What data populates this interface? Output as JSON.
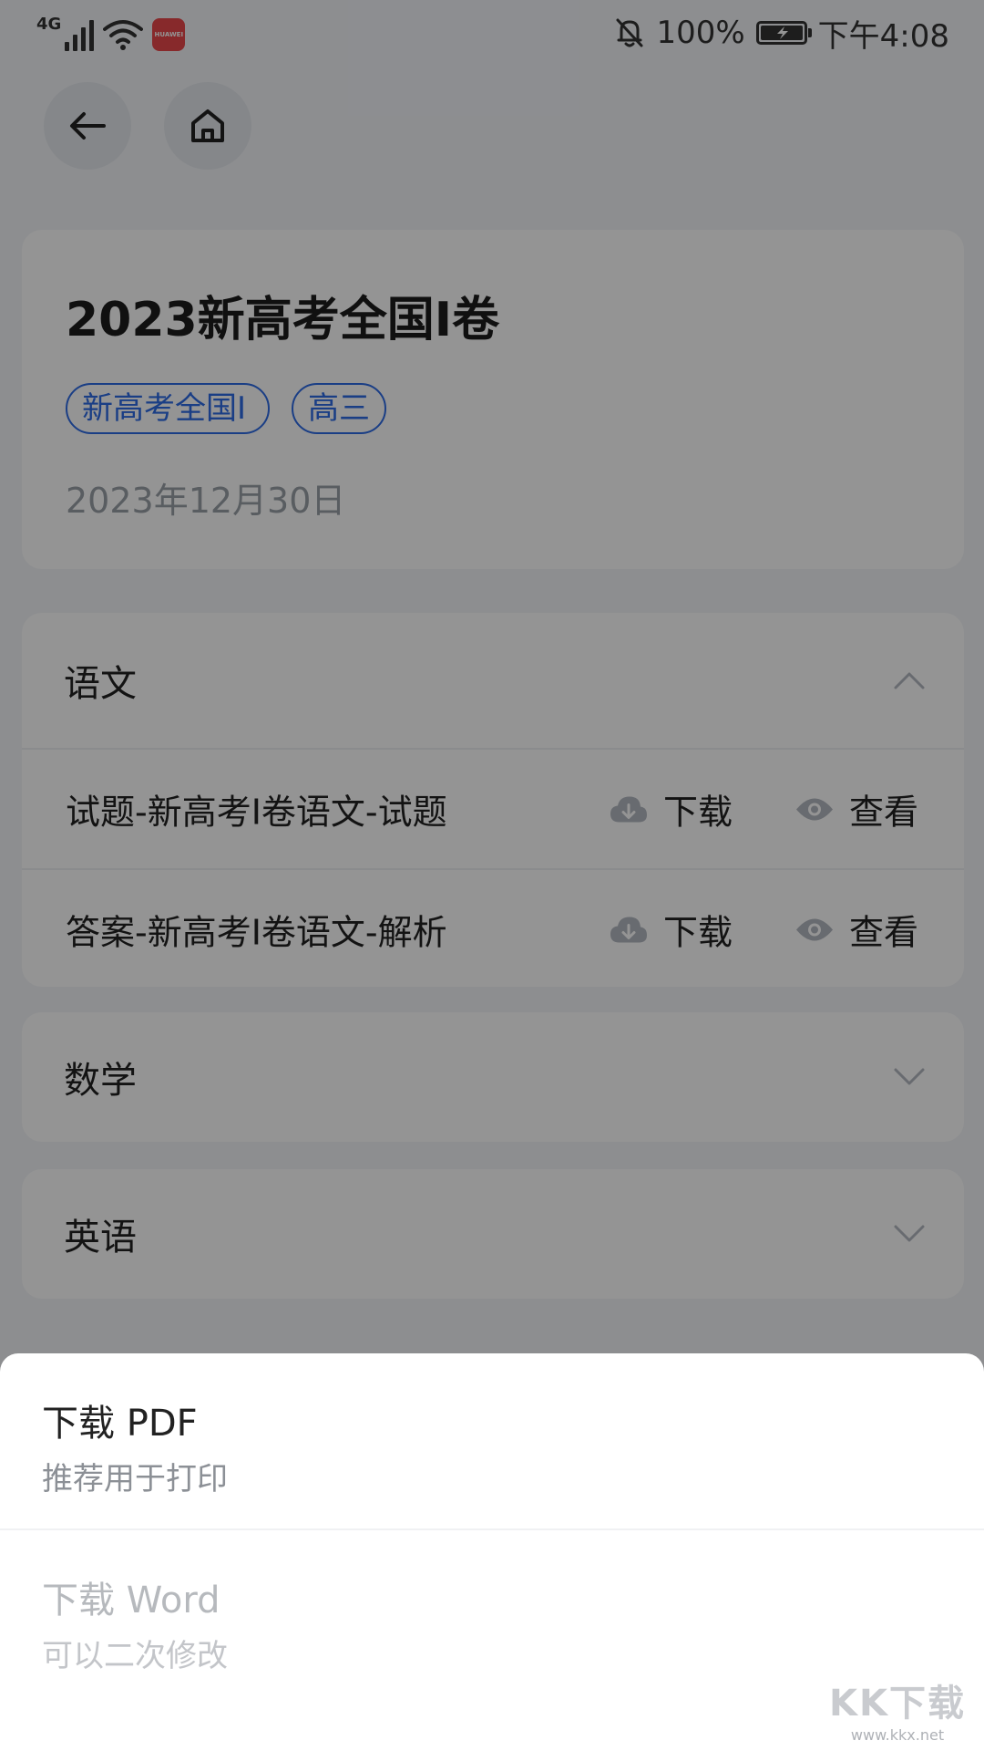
{
  "status_bar": {
    "network": "4G",
    "app_icon_label": "HUAWEI",
    "battery_percent": "100%",
    "time": "下午4:08",
    "icons": [
      "signal-icon",
      "wifi-icon",
      "bell-off-icon",
      "battery-charging-icon"
    ]
  },
  "nav": {
    "back_icon": "arrow-left-icon",
    "home_icon": "home-icon"
  },
  "paper": {
    "title": "2023新高考全国Ⅰ卷",
    "tags": [
      "新高考全国Ⅰ",
      "高三"
    ],
    "date": "2023年12月30日"
  },
  "subjects": [
    {
      "name": "语文",
      "expanded": true,
      "files": [
        {
          "name": "试题-新高考Ⅰ卷语文-试题",
          "download_label": "下载",
          "view_label": "查看"
        },
        {
          "name": "答案-新高考Ⅰ卷语文-解析",
          "download_label": "下载",
          "view_label": "查看"
        }
      ]
    },
    {
      "name": "数学",
      "expanded": false
    },
    {
      "name": "英语",
      "expanded": false
    }
  ],
  "sheet": {
    "options": [
      {
        "title": "下载 PDF",
        "subtitle": "推荐用于打印",
        "enabled": true
      },
      {
        "title": "下载 Word",
        "subtitle": "可以二次修改",
        "enabled": false
      }
    ]
  },
  "watermark": {
    "logo": "KK下载",
    "url": "www.kkx.net"
  },
  "colors": {
    "accent": "#2e6be6",
    "overlay": "rgba(0,0,0,0.42)",
    "icon_gray": "#b4b9c1"
  }
}
